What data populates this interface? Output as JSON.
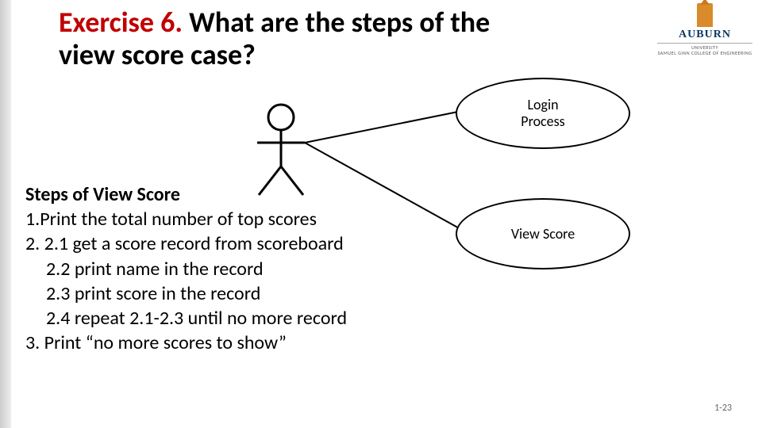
{
  "title": {
    "prefix": "Exercise 6.",
    "rest": " What are the steps of the view score case?"
  },
  "logo": {
    "name": "AUBURN",
    "sub1": "UNIVERSITY",
    "sub2": "SAMUEL GINN COLLEGE OF ENGINEERING"
  },
  "usecases": {
    "login": "Login\nProcess",
    "viewscore": "View Score"
  },
  "steps": {
    "heading": "Steps of View Score",
    "l1": "1.Print the total number of top scores",
    "l2": "2. 2.1 get a score record from scoreboard",
    "l3": "2.2 print name in the record",
    "l4": "2.3 print score in the record",
    "l5": "2.4 repeat 2.1-2.3 until no more record",
    "l6": "3. Print “no more scores to show”"
  },
  "footer": "1-23"
}
